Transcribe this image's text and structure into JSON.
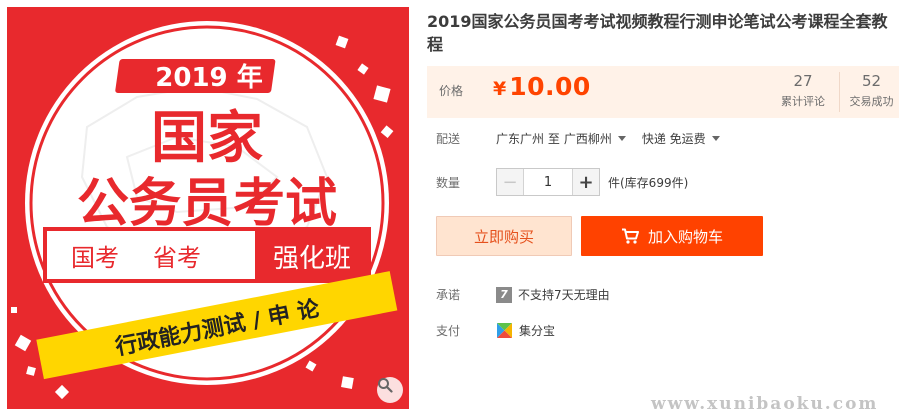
{
  "product": {
    "title": "2019国家公务员国考考试视频教程行测申论笔试公考课程全套教程",
    "image": {
      "banner_year": "2019 年",
      "headline_1": "国家",
      "headline_2": "公务员考试",
      "tag_1": "国考",
      "tag_2": "省考",
      "tag_3": "强化班",
      "ribbon": "行政能力测试 / 申 论"
    }
  },
  "price": {
    "label": "价格",
    "currency": "¥",
    "amount": "10.00",
    "color": "#ff4400"
  },
  "stats": [
    {
      "value": "27",
      "label": "累计评论"
    },
    {
      "value": "52",
      "label": "交易成功"
    }
  ],
  "delivery": {
    "label": "配送",
    "from": "广东广州 至",
    "to": "广西柳州",
    "method": "快递 免运费"
  },
  "quantity": {
    "label": "数量",
    "value": "1",
    "minus": "−",
    "plus": "+",
    "stock": "件(库存699件)"
  },
  "actions": {
    "buy_now": "立即购买",
    "add_to_cart": "加入购物车",
    "accent": "#ff4200"
  },
  "promise": {
    "label": "承诺",
    "icon_glyph": "7",
    "text": "不支持7天无理由"
  },
  "payment": {
    "label": "支付",
    "method": "集分宝"
  },
  "watermark": "www.xunibaoku.com"
}
